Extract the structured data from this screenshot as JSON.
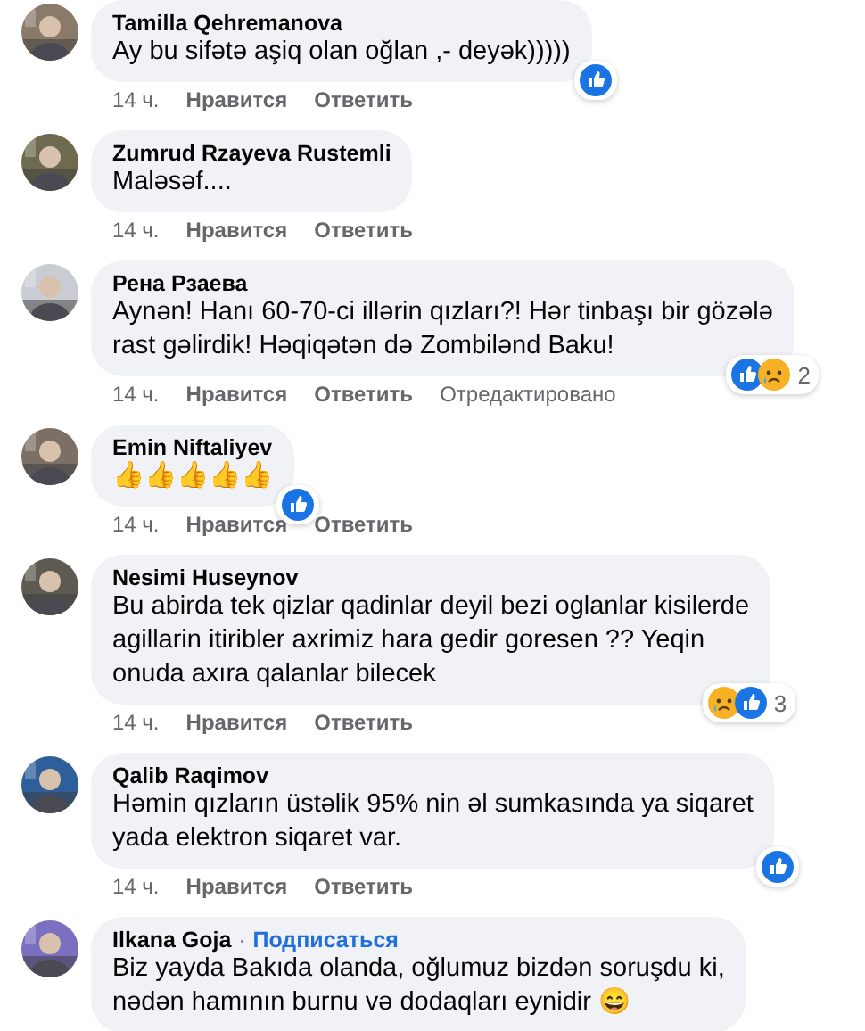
{
  "comments": [
    {
      "author": "Tamilla Qehremanova",
      "lines": [
        "Ay bu sifətə aşiq olan oğlan ,- deyək)))))"
      ],
      "reactions": [
        {
          "kind": "like"
        }
      ],
      "time": "14 ч.",
      "actions": [
        "Нравится",
        "Ответить"
      ]
    },
    {
      "author": "Zumrud Rzayeva Rustemli",
      "lines": [
        "Maləsəf...."
      ],
      "time": "14 ч.",
      "actions": [
        "Нравится",
        "Ответить"
      ]
    },
    {
      "author": "Рена Рзаева",
      "lines": [
        "Aynən! Hanı 60-70-ci illərin qızları?! Hər tinbaşı bir gözələ",
        "rast gəlirdik! Həqiqətən də Zombilənd Baku!"
      ],
      "reactions": [
        {
          "kind": "like"
        },
        {
          "kind": "sad"
        }
      ],
      "reaction_count": "2",
      "time": "14 ч.",
      "actions": [
        "Нравится",
        "Ответить"
      ],
      "edited": "Отредактировано"
    },
    {
      "author": "Emin Niftaliyev",
      "lines": [
        "👍👍👍👍👍"
      ],
      "reactions": [
        {
          "kind": "like"
        }
      ],
      "time": "14 ч.",
      "actions": [
        "Нравится",
        "Ответить"
      ]
    },
    {
      "author": "Nesimi Huseynov",
      "lines": [
        "Bu abirda tek qizlar qadinlar deyil bezi oglanlar kisilerde",
        "agillarin itiribler axrimiz hara gedir goresen ?? Yeqin",
        "onuda axıra qalanlar bilecek"
      ],
      "reactions": [
        {
          "kind": "sad"
        },
        {
          "kind": "like"
        }
      ],
      "reaction_count": "3",
      "time": "14 ч.",
      "actions": [
        "Нравится",
        "Ответить"
      ]
    },
    {
      "author": "Qalib Raqimov",
      "lines": [
        "Həmin qızların üstəlik 95% nin əl sumkasında ya siqaret",
        "yada elektron siqaret var."
      ],
      "reactions": [
        {
          "kind": "like"
        }
      ],
      "time": "14 ч.",
      "actions": [
        "Нравится",
        "Ответить"
      ]
    },
    {
      "author": "Ilkana Goja",
      "separator": "·",
      "follow": "Подписаться",
      "lines": [
        "Biz yayda Bakıda olanda, oğlumuz bizdən soruşdu ki,",
        "nədən hamının burnu və dodaqları eynidir 😄"
      ]
    }
  ]
}
